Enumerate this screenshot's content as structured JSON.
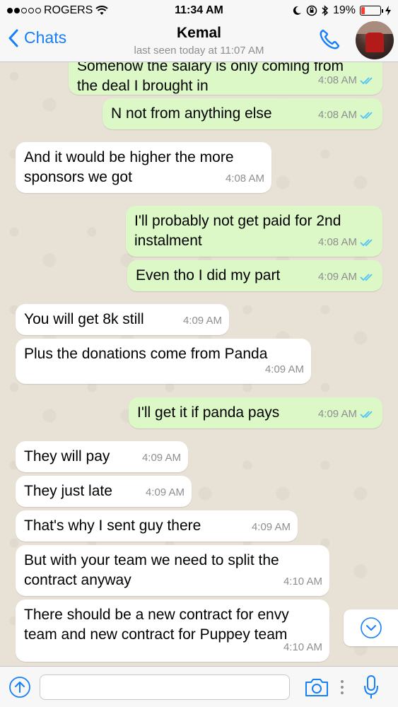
{
  "status_bar": {
    "carrier": "ROGERS",
    "time": "11:34 AM",
    "battery_percent": "19%",
    "battery_level": 0.19,
    "icons": [
      "signal-dots",
      "wifi-icon",
      "moon-icon",
      "rotation-lock-icon",
      "bluetooth-icon",
      "battery-icon",
      "charging-icon"
    ]
  },
  "header": {
    "back_label": "Chats",
    "contact_name": "Kemal",
    "last_seen": "last seen today at 11:07 AM",
    "icons": [
      "chevron-left-icon",
      "phone-icon",
      "avatar"
    ]
  },
  "messages": [
    {
      "dir": "out",
      "lines": [
        "Somehow the salary is only coming from",
        "the deal I brought in"
      ],
      "time": "4:08 AM",
      "read": true
    },
    {
      "dir": "out",
      "lines": [
        "N not from anything else"
      ],
      "time": "4:08 AM",
      "read": true
    },
    {
      "dir": "in",
      "lines": [
        "And it would be higher the more",
        "sponsors we got"
      ],
      "time": "4:08 AM"
    },
    {
      "dir": "out",
      "lines": [
        "I'll probably not get paid for 2nd",
        "instalment"
      ],
      "time": "4:08 AM",
      "read": true
    },
    {
      "dir": "out",
      "lines": [
        "Even tho I did my part"
      ],
      "time": "4:09 AM",
      "read": true
    },
    {
      "dir": "in",
      "lines": [
        "You will get 8k still"
      ],
      "time": "4:09 AM"
    },
    {
      "dir": "in",
      "lines": [
        "Plus the donations come from Panda"
      ],
      "time": "4:09 AM"
    },
    {
      "dir": "out",
      "lines": [
        "I'll get it if panda pays"
      ],
      "time": "4:09 AM",
      "read": true
    },
    {
      "dir": "in",
      "lines": [
        "They will pay"
      ],
      "time": "4:09 AM"
    },
    {
      "dir": "in",
      "lines": [
        "They just late"
      ],
      "time": "4:09 AM"
    },
    {
      "dir": "in",
      "lines": [
        "That's why I sent guy there"
      ],
      "time": "4:09 AM"
    },
    {
      "dir": "in",
      "lines": [
        "But with your team we need to split the",
        "contract anyway"
      ],
      "time": "4:10 AM"
    },
    {
      "dir": "in",
      "lines": [
        "There should be a new contract for envy",
        "team and new contract for Puppey team"
      ],
      "time": "4:10 AM"
    }
  ],
  "input_bar": {
    "placeholder": "",
    "icons": [
      "attach-arrow-icon",
      "camera-icon",
      "more-dots-icon",
      "microphone-icon"
    ]
  },
  "scroll_button_icon": "chevron-down-circle-icon",
  "colors": {
    "outgoing_bubble": "#dcf8c6",
    "incoming_bubble": "#ffffff",
    "chat_background": "#e5ddd5",
    "accent_blue": "#147efb",
    "read_ticks": "#4fc3f7",
    "battery_low": "#ff3b30"
  }
}
